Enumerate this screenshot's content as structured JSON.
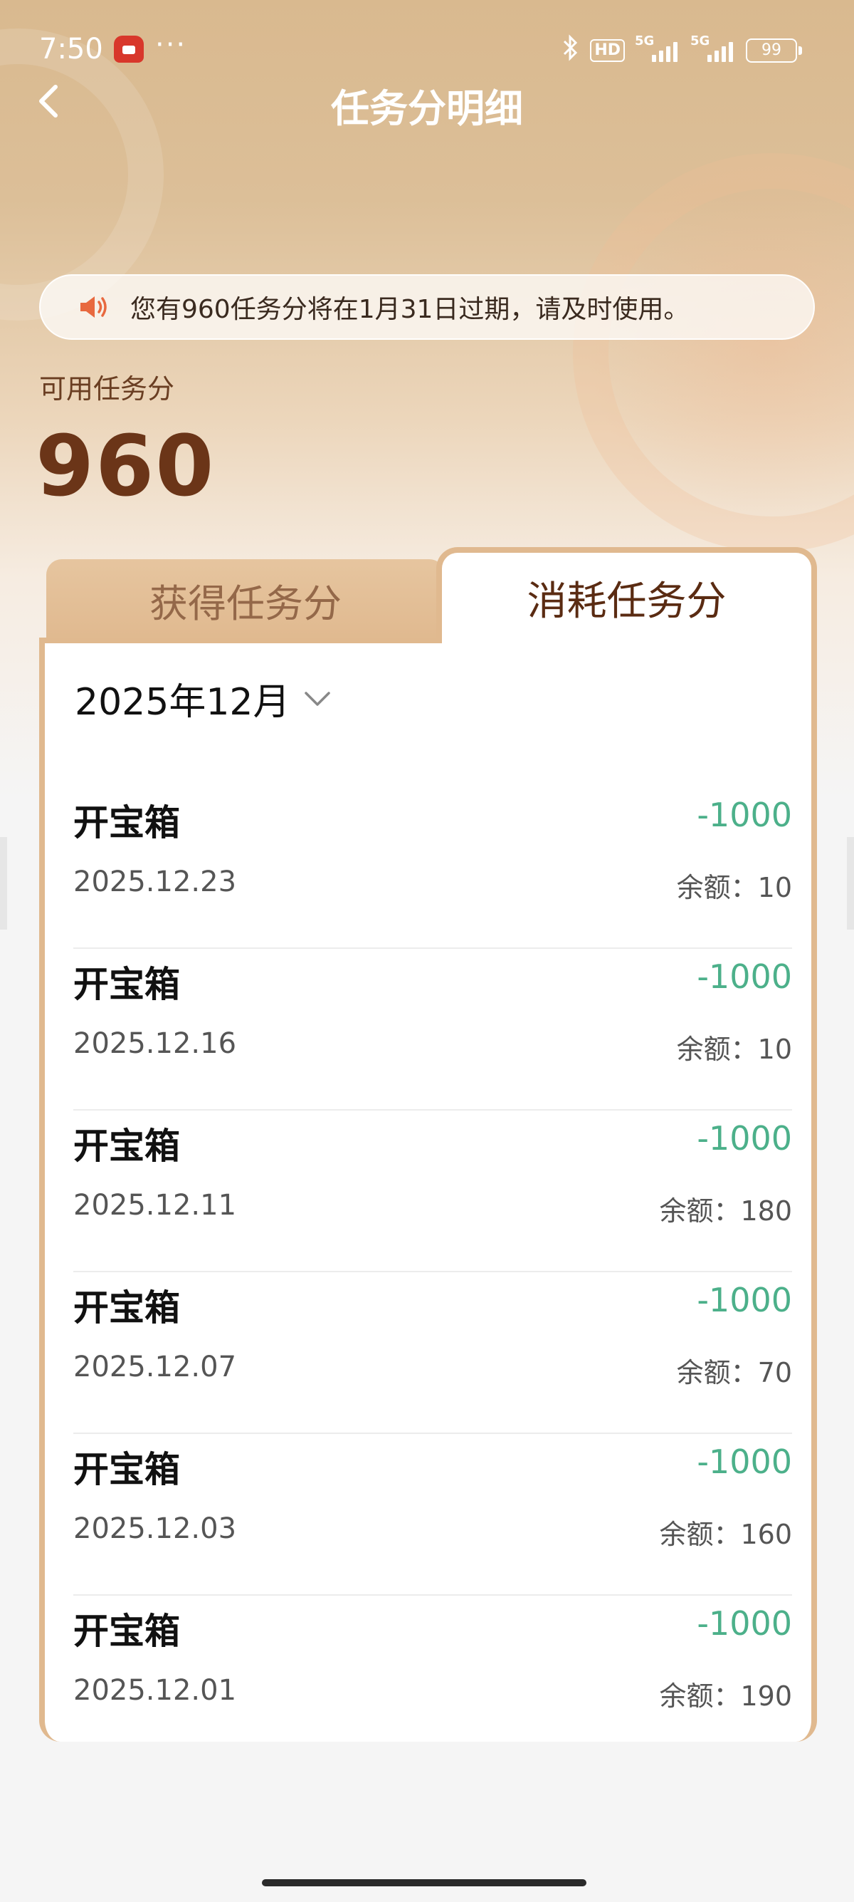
{
  "status_bar": {
    "time": "7:50",
    "more": "···",
    "hd_badge": "HD",
    "signal_1_label": "5G",
    "signal_2_label": "5G",
    "battery": "99"
  },
  "header": {
    "title": "任务分明细"
  },
  "notice": {
    "text": "您有960任务分将在1月31日过期，请及时使用。",
    "icon": "speaker-icon",
    "icon_color": "#e8693f"
  },
  "balance": {
    "label": "可用任务分",
    "value": "960"
  },
  "tabs": {
    "earn": "获得任务分",
    "spend": "消耗任务分",
    "selected": "spend"
  },
  "filter": {
    "month": "2025年12月"
  },
  "colors": {
    "accent_brown": "#6b3518",
    "tab_border": "#e0b98f",
    "amount_green": "#4cb08a"
  },
  "records": [
    {
      "title": "开宝箱",
      "date": "2025.12.23",
      "amount": "-1000",
      "balance": "余额：10"
    },
    {
      "title": "开宝箱",
      "date": "2025.12.16",
      "amount": "-1000",
      "balance": "余额：10"
    },
    {
      "title": "开宝箱",
      "date": "2025.12.11",
      "amount": "-1000",
      "balance": "余额：180"
    },
    {
      "title": "开宝箱",
      "date": "2025.12.07",
      "amount": "-1000",
      "balance": "余额：70"
    },
    {
      "title": "开宝箱",
      "date": "2025.12.03",
      "amount": "-1000",
      "balance": "余额：160"
    },
    {
      "title": "开宝箱",
      "date": "2025.12.01",
      "amount": "-1000",
      "balance": "余额：190"
    }
  ]
}
